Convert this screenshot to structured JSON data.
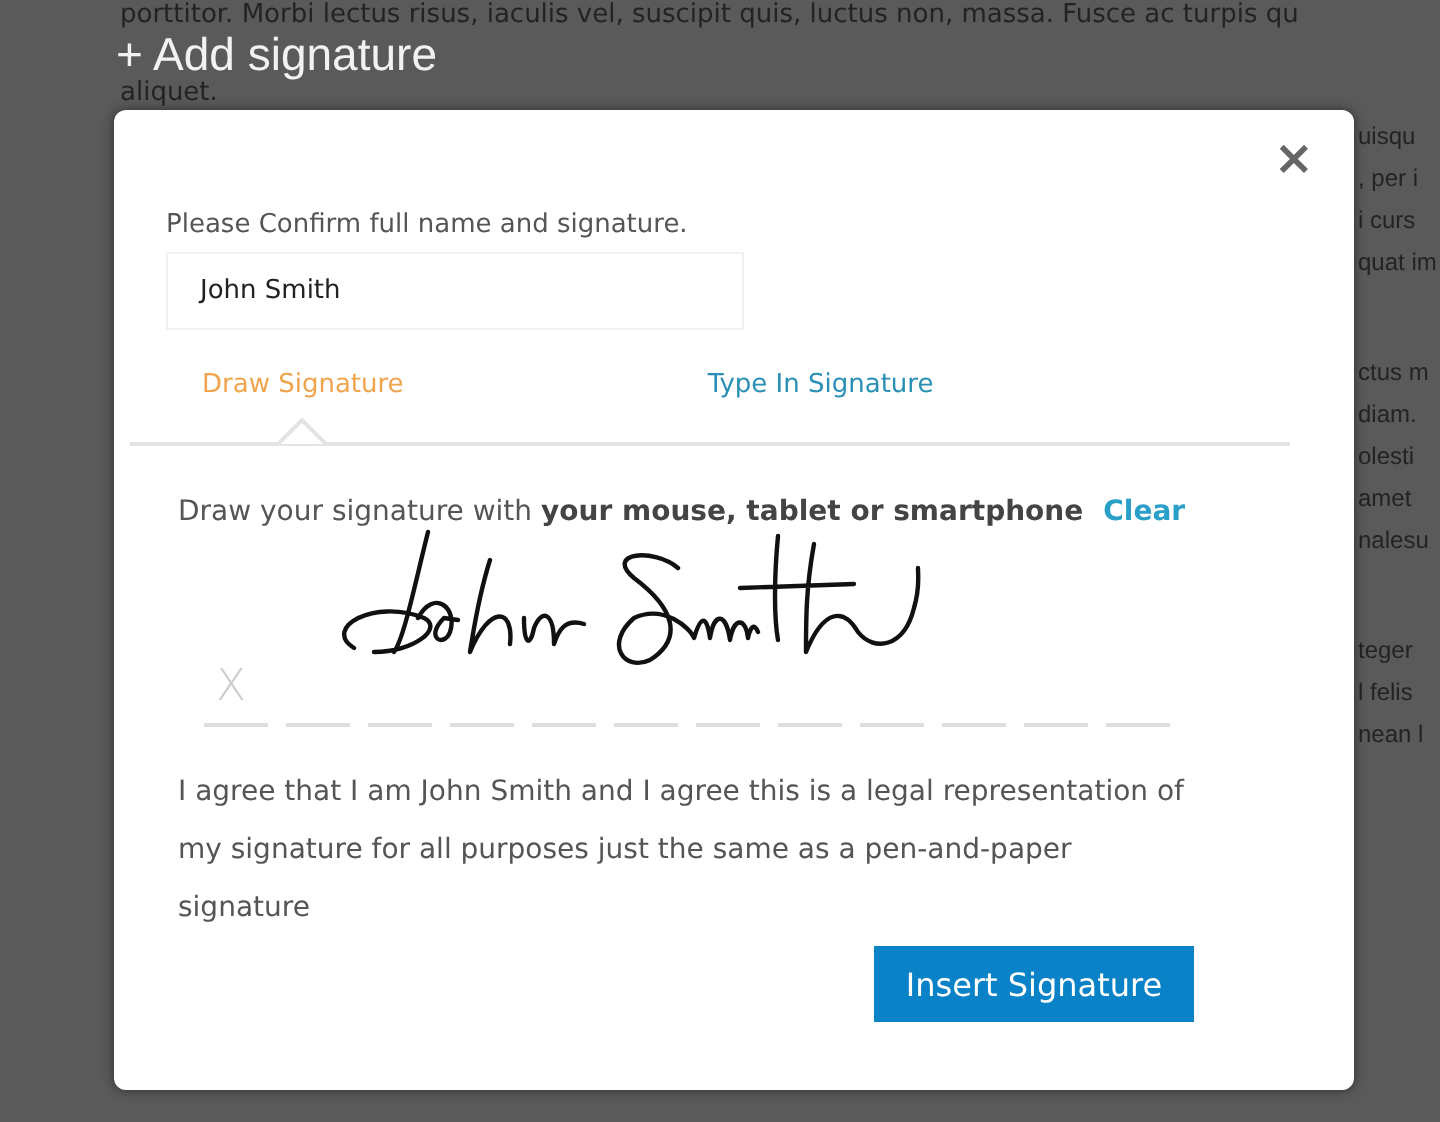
{
  "background": {
    "lines": [
      "porttitor. Morbi lectus risus, iaculis vel, suscipit quis, luctus non, massa. Fusce ac turpis qu",
      "aliquet."
    ],
    "heading": "+ Add signature",
    "side_paragraphs": [
      [
        "uisqu",
        ", per i",
        "i curs",
        "quat im"
      ],
      [
        "ctus m",
        "diam.",
        "olesti",
        "amet",
        "nalesu"
      ],
      [
        "teger",
        "l felis",
        "nean l"
      ]
    ]
  },
  "dialog": {
    "close": "×",
    "prompt": "Please Confirm full name and signature.",
    "name_field": {
      "value": "John Smith"
    },
    "tabs": [
      {
        "label": "Draw Signature",
        "selected": true
      },
      {
        "label": "Type In Signature",
        "selected": false
      }
    ],
    "instruction": "Draw your signature with **your mouse, tablet or smartphone**",
    "clear": "Clear",
    "pad": {
      "mark": "X"
    },
    "agreement": "I agree that I am John Smith and I agree this is a legal representation of my signature for all purposes just the same as a pen-and-paper signature",
    "submit": "Insert Signature"
  }
}
